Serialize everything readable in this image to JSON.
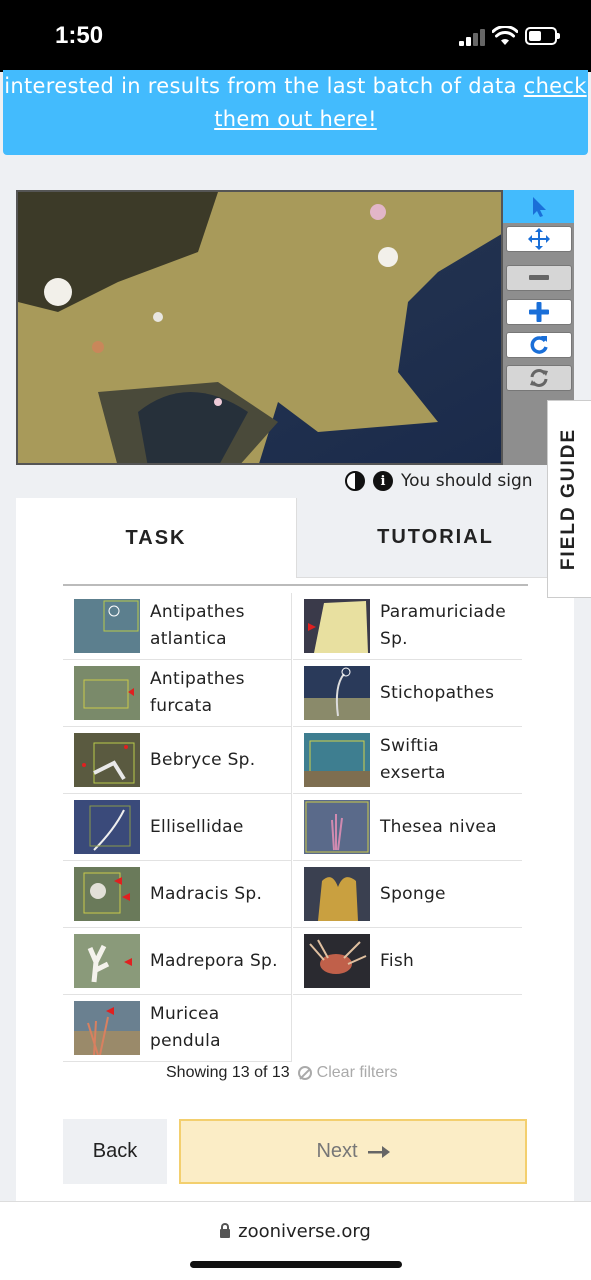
{
  "status_bar": {
    "time": "1:50"
  },
  "banner": {
    "text": "interested in results from the last batch of data ",
    "link_part1": "check",
    "link_part2": "them out here!"
  },
  "viewer": {
    "caption": "You should sign"
  },
  "field_guide": {
    "label": "FIELD GUIDE"
  },
  "tabs": {
    "task": "TASK",
    "tutorial": "TUTORIAL"
  },
  "choices": [
    {
      "label": "Antipathes atlantica",
      "thumb": "antipathes-atlantica"
    },
    {
      "label": "Paramuriciade Sp.",
      "thumb": "paramuriciade"
    },
    {
      "label": "Antipathes furcata",
      "thumb": "antipathes-furcata"
    },
    {
      "label": "Stichopathes",
      "thumb": "stichopathes"
    },
    {
      "label": "Bebryce Sp.",
      "thumb": "bebryce"
    },
    {
      "label": "Swiftia exserta",
      "thumb": "swiftia"
    },
    {
      "label": "Ellisellidae",
      "thumb": "ellisellidae"
    },
    {
      "label": "Thesea nivea",
      "thumb": "thesea"
    },
    {
      "label": "Madracis Sp.",
      "thumb": "madracis"
    },
    {
      "label": "Sponge",
      "thumb": "sponge"
    },
    {
      "label": "Madrepora Sp.",
      "thumb": "madrepora"
    },
    {
      "label": "Fish",
      "thumb": "fish"
    },
    {
      "label": "Muricea pendula",
      "thumb": "muricea"
    }
  ],
  "filter_summary": {
    "showing": "Showing 13 of 13",
    "clear": "Clear filters"
  },
  "nav": {
    "back": "Back",
    "next": "Next"
  },
  "browser": {
    "url": "zooniverse.org"
  },
  "colors": {
    "accent": "#43bbfd",
    "next_bg": "#fbedc6",
    "next_border": "#f3cf6e"
  }
}
